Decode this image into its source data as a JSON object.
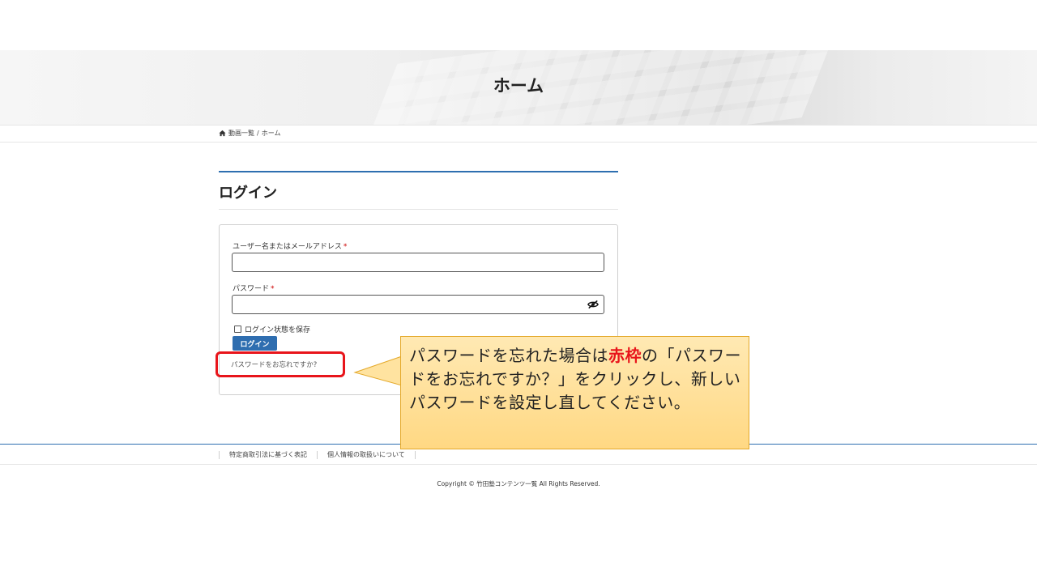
{
  "hero": {
    "title": "ホーム"
  },
  "breadcrumb": {
    "items": [
      "動画一覧",
      "ホーム"
    ],
    "separator": "/"
  },
  "content": {
    "title": "ログイン"
  },
  "login_form": {
    "username_label": "ユーザー名またはメールアドレス",
    "password_label": "パスワード",
    "required_mark": "*",
    "username_value": "",
    "password_value": "",
    "remember_label": "ログイン状態を保存",
    "remember_checked": false,
    "submit_label": "ログイン",
    "lost_password_link": "パスワードをお忘れですか?"
  },
  "footer": {
    "links": [
      "特定商取引法に基づく表記",
      "個人情報の取扱いについて"
    ],
    "copyright": "Copyright © 竹田塾コンテンツ一覧 All Rights Reserved."
  },
  "callout": {
    "text_before": "パスワードを忘れた場合は",
    "emphasis": "赤枠",
    "text_after": "の「パスワードをお忘れですか？」をクリックし、新しいパスワードを設定し直してください。"
  },
  "colors": {
    "accent": "#2e6fb0",
    "highlight": "#e8151b",
    "callout_fill": "#ffd883",
    "callout_border": "#e4a92b"
  },
  "icons": {
    "breadcrumb_home": "home-icon",
    "password_toggle": "eye-slash-icon"
  }
}
